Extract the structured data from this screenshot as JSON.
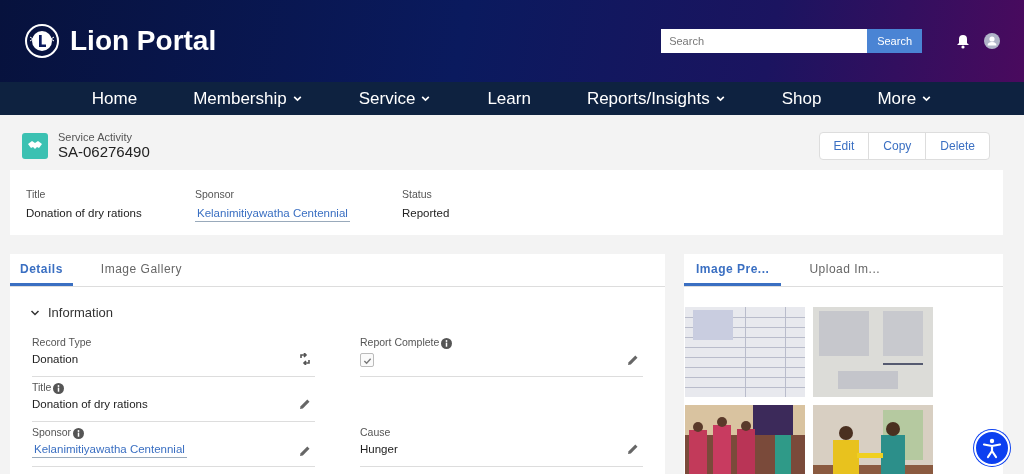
{
  "header": {
    "logo_text": "Lion Portal",
    "search": {
      "placeholder": "Search",
      "button": "Search"
    }
  },
  "nav": [
    {
      "label": "Home",
      "dropdown": false
    },
    {
      "label": "Membership",
      "dropdown": true
    },
    {
      "label": "Service",
      "dropdown": true
    },
    {
      "label": "Learn",
      "dropdown": false
    },
    {
      "label": "Reports/Insights",
      "dropdown": true
    },
    {
      "label": "Shop",
      "dropdown": false
    },
    {
      "label": "More",
      "dropdown": true
    }
  ],
  "record": {
    "type": "Service Activity",
    "name": "SA-06276490",
    "actions": [
      "Edit",
      "Copy",
      "Delete"
    ]
  },
  "highlights": [
    {
      "label": "Title",
      "value": "Donation of dry rations",
      "kind": "text"
    },
    {
      "label": "Sponsor",
      "value": "Kelanimitiyawatha Centennial",
      "kind": "link"
    },
    {
      "label": "Status",
      "value": "Reported",
      "kind": "text"
    }
  ],
  "detail_tabs": [
    {
      "label": "Details",
      "selected": true
    },
    {
      "label": "Image Gallery",
      "selected": false
    }
  ],
  "section": {
    "title": "Information",
    "expanded": true
  },
  "fields_left": [
    {
      "label": "Record Type",
      "info": false,
      "value": "Donation",
      "kind": "text",
      "editable": false
    },
    {
      "label": "Title",
      "info": true,
      "value": "Donation of dry rations",
      "kind": "text",
      "editable": true
    },
    {
      "label": "Sponsor",
      "info": true,
      "value": "Kelanimitiyawatha Centennial",
      "kind": "link",
      "editable": true
    }
  ],
  "fields_right": [
    {
      "label": "Report Complete",
      "info": true,
      "kind": "checkbox",
      "checked": true,
      "editable": true
    },
    {
      "kind": "blank"
    },
    {
      "label": "Cause",
      "info": false,
      "value": "Hunger",
      "kind": "text",
      "editable": true
    }
  ],
  "side_tabs": [
    {
      "label": "Image Pre...",
      "selected": true
    },
    {
      "label": "Upload Im...",
      "selected": false
    }
  ]
}
